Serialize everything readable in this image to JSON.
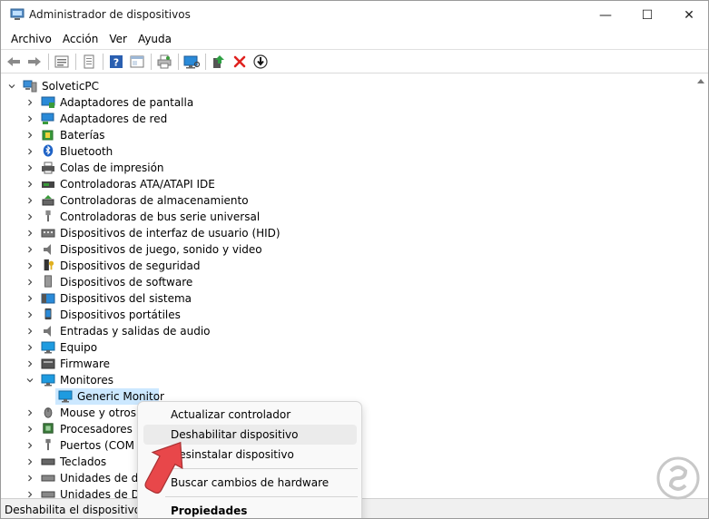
{
  "window": {
    "title": "Administrador de dispositivos",
    "minimize_glyph": "—",
    "maximize_glyph": "☐",
    "close_glyph": "✕"
  },
  "menu": [
    "Archivo",
    "Acción",
    "Ver",
    "Ayuda"
  ],
  "tree": {
    "root": "SolveticPC",
    "categories": [
      "Adaptadores de pantalla",
      "Adaptadores de red",
      "Baterías",
      "Bluetooth",
      "Colas de impresión",
      "Controladoras ATA/ATAPI IDE",
      "Controladoras de almacenamiento",
      "Controladoras de bus serie universal",
      "Dispositivos de interfaz de usuario (HID)",
      "Dispositivos de juego, sonido y video",
      "Dispositivos de seguridad",
      "Dispositivos de software",
      "Dispositivos del sistema",
      "Dispositivos portátiles",
      "Entradas y salidas de audio",
      "Equipo",
      "Firmware",
      "Monitores"
    ],
    "expanded_child": "Generic Monitor",
    "after": [
      "Mouse y otros d",
      "Procesadores",
      "Puertos (COM y",
      "Teclados",
      "Unidades de dis",
      "Unidades de DV"
    ]
  },
  "context_menu": {
    "update_driver": "Actualizar controlador",
    "disable_device": "Deshabilitar dispositivo",
    "uninstall_device": "Desinstalar dispositivo",
    "scan_hardware": "Buscar cambios de hardware",
    "properties": "Propiedades"
  },
  "status": {
    "text": "Deshabilita el dispositivo sel"
  },
  "colors": {
    "selection": "#cce8ff",
    "arrow": "#e8474a",
    "monitor_icon": "#1e9be0"
  },
  "icons": {
    "back": "arrow-left-icon",
    "forward": "arrow-right-icon",
    "remove": "red-x-icon"
  }
}
